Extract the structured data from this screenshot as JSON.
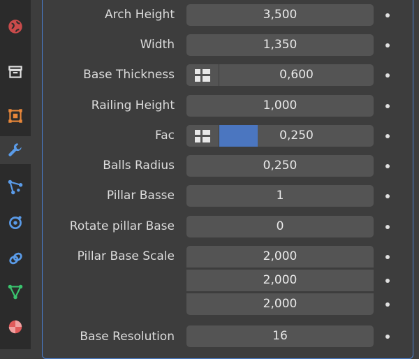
{
  "sidebar": {
    "tabs": [
      {
        "icon": "world-icon"
      },
      {
        "icon": "collection-icon"
      },
      {
        "icon": "object-icon"
      },
      {
        "icon": "modifier-wrench-icon",
        "active": true
      },
      {
        "icon": "particles-icon"
      },
      {
        "icon": "physics-icon"
      },
      {
        "icon": "constraints-icon"
      },
      {
        "icon": "data-mesh-icon"
      },
      {
        "icon": "material-icon"
      }
    ]
  },
  "properties": [
    {
      "label": "Arch Height",
      "value": "3,500"
    },
    {
      "label": "Width",
      "value": "1,350"
    },
    {
      "label": "Base Thickness",
      "value": "0,600",
      "node_socket": true
    },
    {
      "label": "Railing Height",
      "value": "1,000"
    },
    {
      "label": "Fac",
      "value": "0,250",
      "node_socket": true,
      "fill_fraction": 0.25
    },
    {
      "label": "Balls Radius",
      "value": "0,250"
    },
    {
      "label": "Pillar Basse",
      "value": "1"
    },
    {
      "label": "Rotate pillar Base",
      "value": "0"
    },
    {
      "label": "Pillar Base Scale",
      "values": [
        "2,000",
        "2,000",
        "2,000"
      ]
    },
    {
      "label": "Base Resolution",
      "value": "16"
    }
  ],
  "colors": {
    "accent": "#4b76c0",
    "field": "#545454",
    "background": "#3d3d3d",
    "panel_border": "#4a7fd0"
  }
}
